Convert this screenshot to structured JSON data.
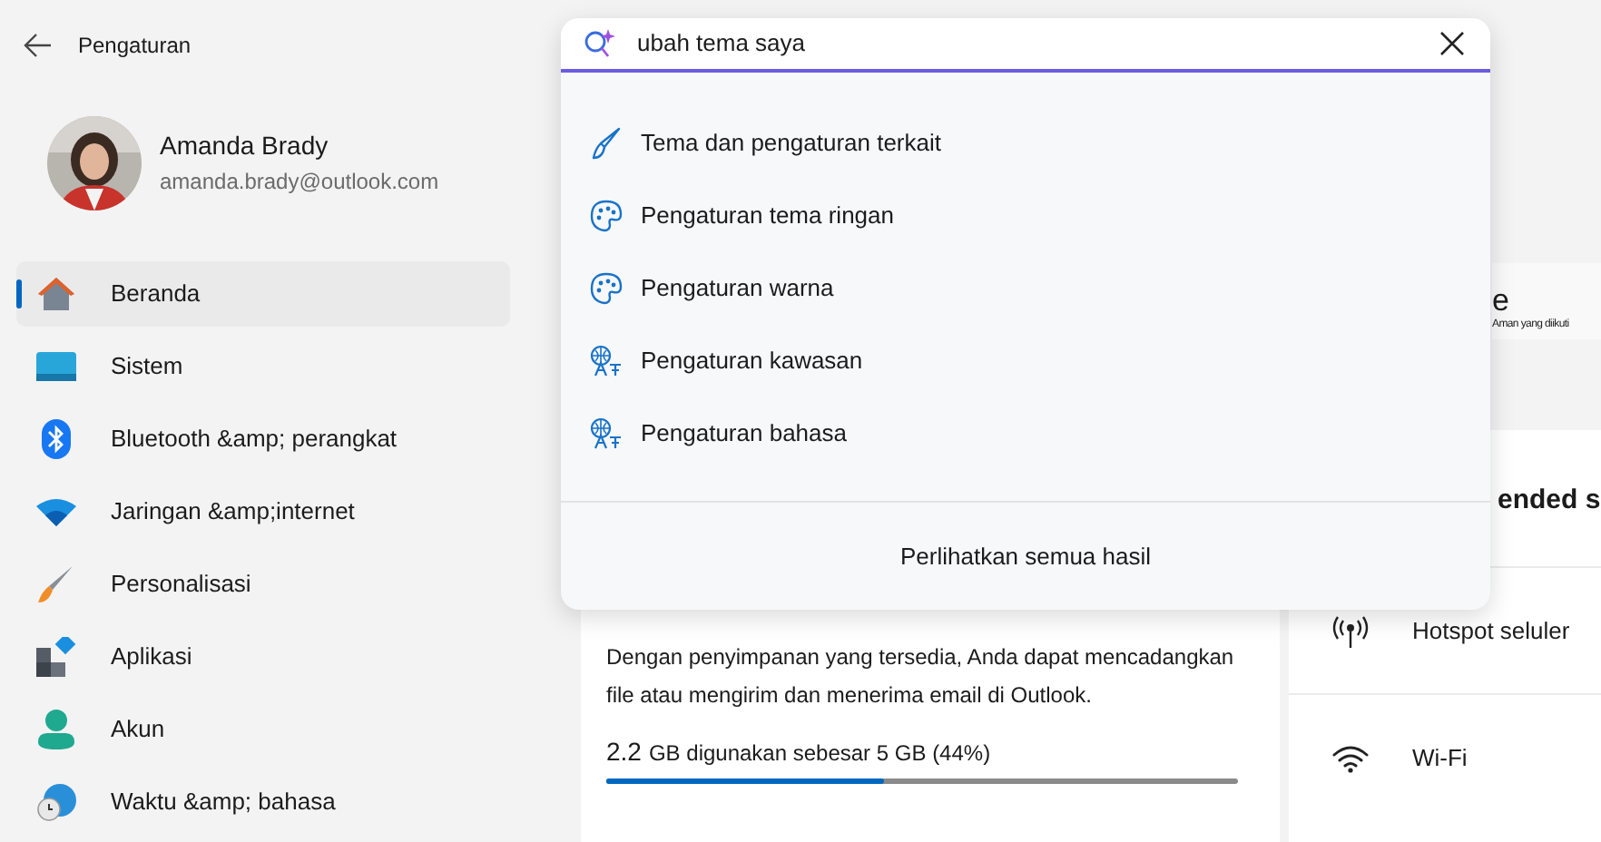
{
  "window": {
    "title": "Pengaturan"
  },
  "profile": {
    "name": "Amanda Brady",
    "email": "amanda.brady@outlook.com"
  },
  "sidebar": {
    "items": [
      {
        "label": "Beranda",
        "kind": "home",
        "selected": true
      },
      {
        "label": "Sistem",
        "kind": "system",
        "selected": false
      },
      {
        "label": "Bluetooth &amp; perangkat",
        "kind": "bluetooth",
        "selected": false
      },
      {
        "label": "Jaringan &amp;internet",
        "kind": "network",
        "selected": false
      },
      {
        "label": "Personalisasi",
        "kind": "brush",
        "selected": false
      },
      {
        "label": "Aplikasi",
        "kind": "apps",
        "selected": false
      },
      {
        "label": "Akun",
        "kind": "account",
        "selected": false
      },
      {
        "label": "Waktu &amp; bahasa",
        "kind": "time",
        "selected": false
      }
    ]
  },
  "search": {
    "value": "ubah tema saya",
    "results": [
      {
        "label": "Tema dan pengaturan terkait",
        "kind": "brush"
      },
      {
        "label": "Pengaturan tema ringan",
        "kind": "palette"
      },
      {
        "label": "Pengaturan warna",
        "kind": "palette"
      },
      {
        "label": "Pengaturan kawasan",
        "kind": "language"
      },
      {
        "label": "Pengaturan bahasa",
        "kind": "language"
      }
    ],
    "show_all": "Perlihatkan semua hasil"
  },
  "partial_card": {
    "title": "e",
    "subtitle": "Aman yang diikuti"
  },
  "storage_card": {
    "description": "Dengan penyimpanan yang tersedia, Anda dapat mencadangkan file atau mengirim dan menerima email di Outlook.",
    "used": "2.2",
    "usage": "GB digunakan sebesar 5 GB (44%)",
    "level": 0.44
  },
  "recommended": {
    "title": "ended s",
    "items": [
      {
        "label": "Hotspot seluler",
        "kind": "hotspot"
      },
      {
        "label": "Wi-Fi",
        "kind": "wifi"
      }
    ]
  }
}
